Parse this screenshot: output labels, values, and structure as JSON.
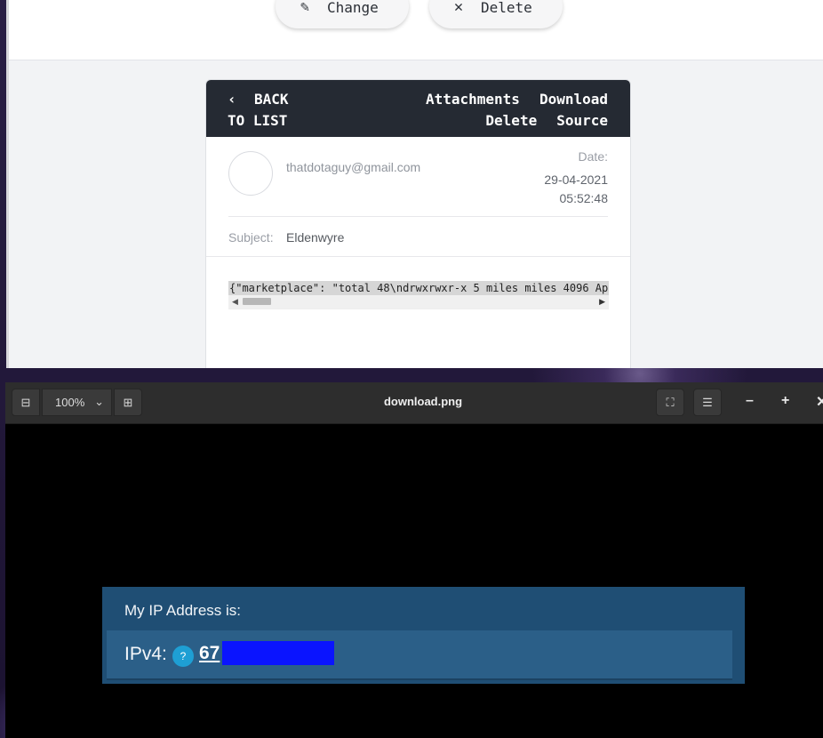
{
  "mail": {
    "toolbar": {
      "change_label": "Change",
      "delete_label": "Delete",
      "change_icon": "pen-icon",
      "delete_icon": "x-icon"
    },
    "header": {
      "back_line1": "BACK",
      "back_line2": "TO LIST",
      "attachments_label": "Attachments",
      "download_label": "Download",
      "delete_label": "Delete",
      "source_label": "Source"
    },
    "sender": "thatdotaguy@gmail.com",
    "date_label": "Date:",
    "date_value": "29-04-2021",
    "time_value": "05:52:48",
    "subject_label": "Subject:",
    "subject_value": "Eldenwyre",
    "body_text": "{\"marketplace\": \"total 48\\ndrwxrwxr-x 5 miles miles 4096 Ap"
  },
  "viewer": {
    "zoom_level": "100%",
    "title": "download.png"
  },
  "ip_image": {
    "heading": "My IP Address is:",
    "label": "IPv4:",
    "help_glyph": "?",
    "value_visible": "67"
  }
}
